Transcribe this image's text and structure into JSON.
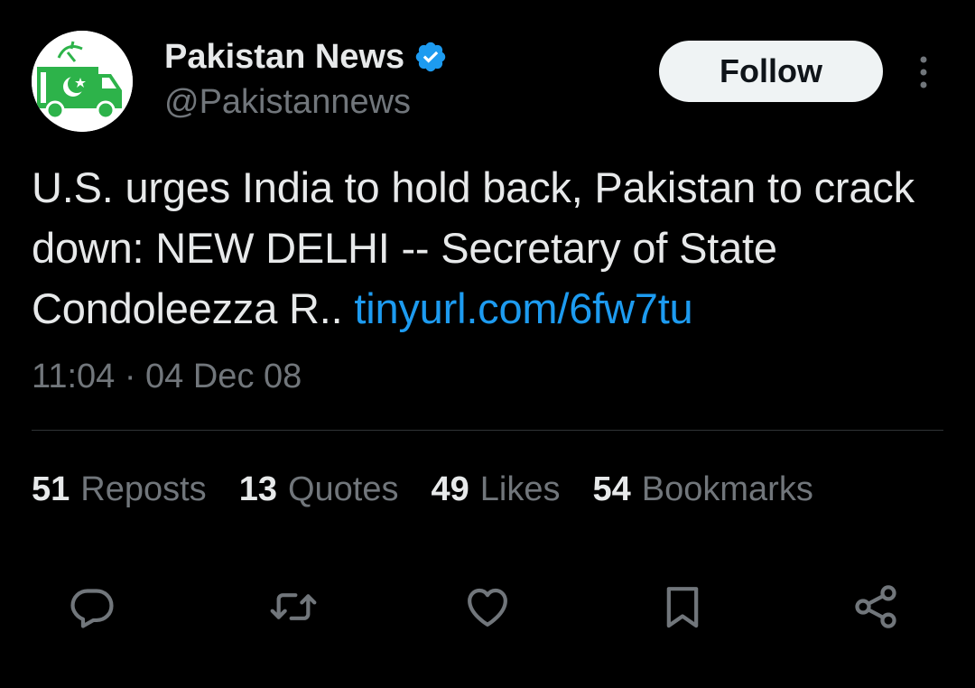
{
  "author": {
    "display_name": "Pakistan News",
    "handle": "@Pakistannews",
    "verified": true,
    "avatar_icon": "satellite-van-pakistan-flag-icon"
  },
  "header": {
    "follow_label": "Follow",
    "more_icon": "more-vertical-icon"
  },
  "tweet": {
    "text": "U.S. urges India to hold back, Pakistan to crack down: NEW DELHI -- Secretary of State Condoleezza R.. ",
    "link": "tinyurl.com/6fw7tu",
    "timestamp": "11:04 · 04 Dec 08"
  },
  "stats": [
    {
      "count": "51",
      "label": "Reposts"
    },
    {
      "count": "13",
      "label": "Quotes"
    },
    {
      "count": "49",
      "label": "Likes"
    },
    {
      "count": "54",
      "label": "Bookmarks"
    }
  ],
  "actions": [
    "reply-icon",
    "repost-icon",
    "like-icon",
    "bookmark-icon",
    "share-icon"
  ],
  "colors": {
    "background": "#000000",
    "primary_text": "#e7e9ea",
    "secondary_text": "#71767b",
    "link": "#1d9bf0",
    "verified_badge": "#1d9bf0",
    "avatar_green": "#2db34a",
    "divider": "#2f3336"
  }
}
